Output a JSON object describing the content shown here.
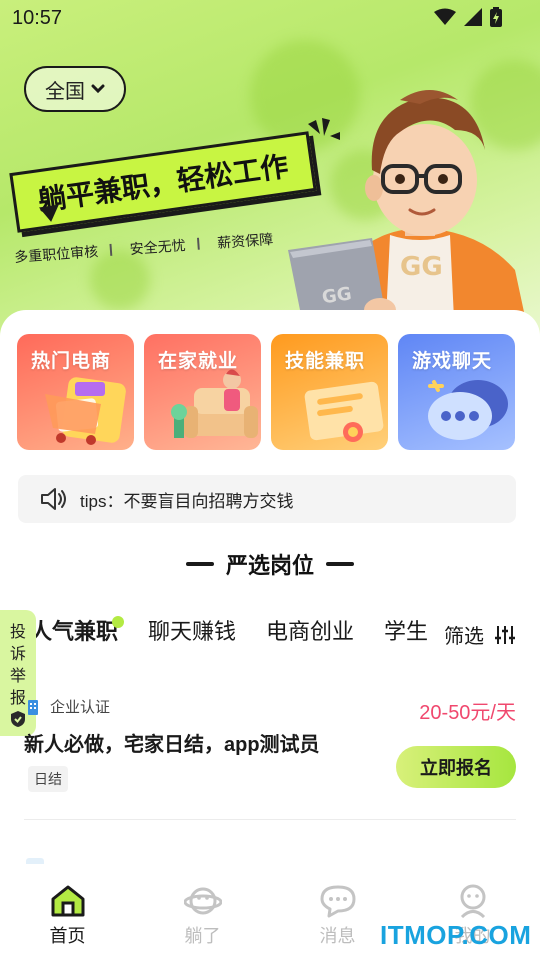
{
  "status_bar": {
    "time": "10:57"
  },
  "header": {
    "region": "全国",
    "slogan": "躺平兼职，轻松工作",
    "features": [
      "多重职位审核",
      "安全无忧",
      "薪资保障"
    ]
  },
  "categories": [
    {
      "label": "热门电商",
      "color": "#ff7a5c"
    },
    {
      "label": "在家就业",
      "color": "#ff8066"
    },
    {
      "label": "技能兼职",
      "color": "#ffa11f"
    },
    {
      "label": "游戏聊天",
      "color": "#6f8ff7"
    }
  ],
  "tips": {
    "text": "tips：不要盲目向招聘方交钱"
  },
  "section": {
    "title": "严选岗位"
  },
  "tabs": [
    "人气兼职",
    "聊天赚钱",
    "电商创业",
    "学生"
  ],
  "filter_label": "筛选",
  "report_label": [
    "投",
    "诉",
    "举",
    "报"
  ],
  "job": {
    "verify": "企业认证",
    "salary": "20-50元/天",
    "title": "新人必做，宅家日结，app测试员",
    "tag": "日结",
    "apply": "立即报名"
  },
  "nav": [
    {
      "label": "首页",
      "icon": "home-icon"
    },
    {
      "label": "躺了",
      "icon": "planet-icon"
    },
    {
      "label": "消息",
      "icon": "message-icon"
    },
    {
      "label": "我的",
      "icon": "profile-icon"
    }
  ],
  "watermark": "ITMOP.COM",
  "colors": {
    "accent": "#b3ea43",
    "salary": "#f0486e",
    "watermark": "#19a3df"
  }
}
